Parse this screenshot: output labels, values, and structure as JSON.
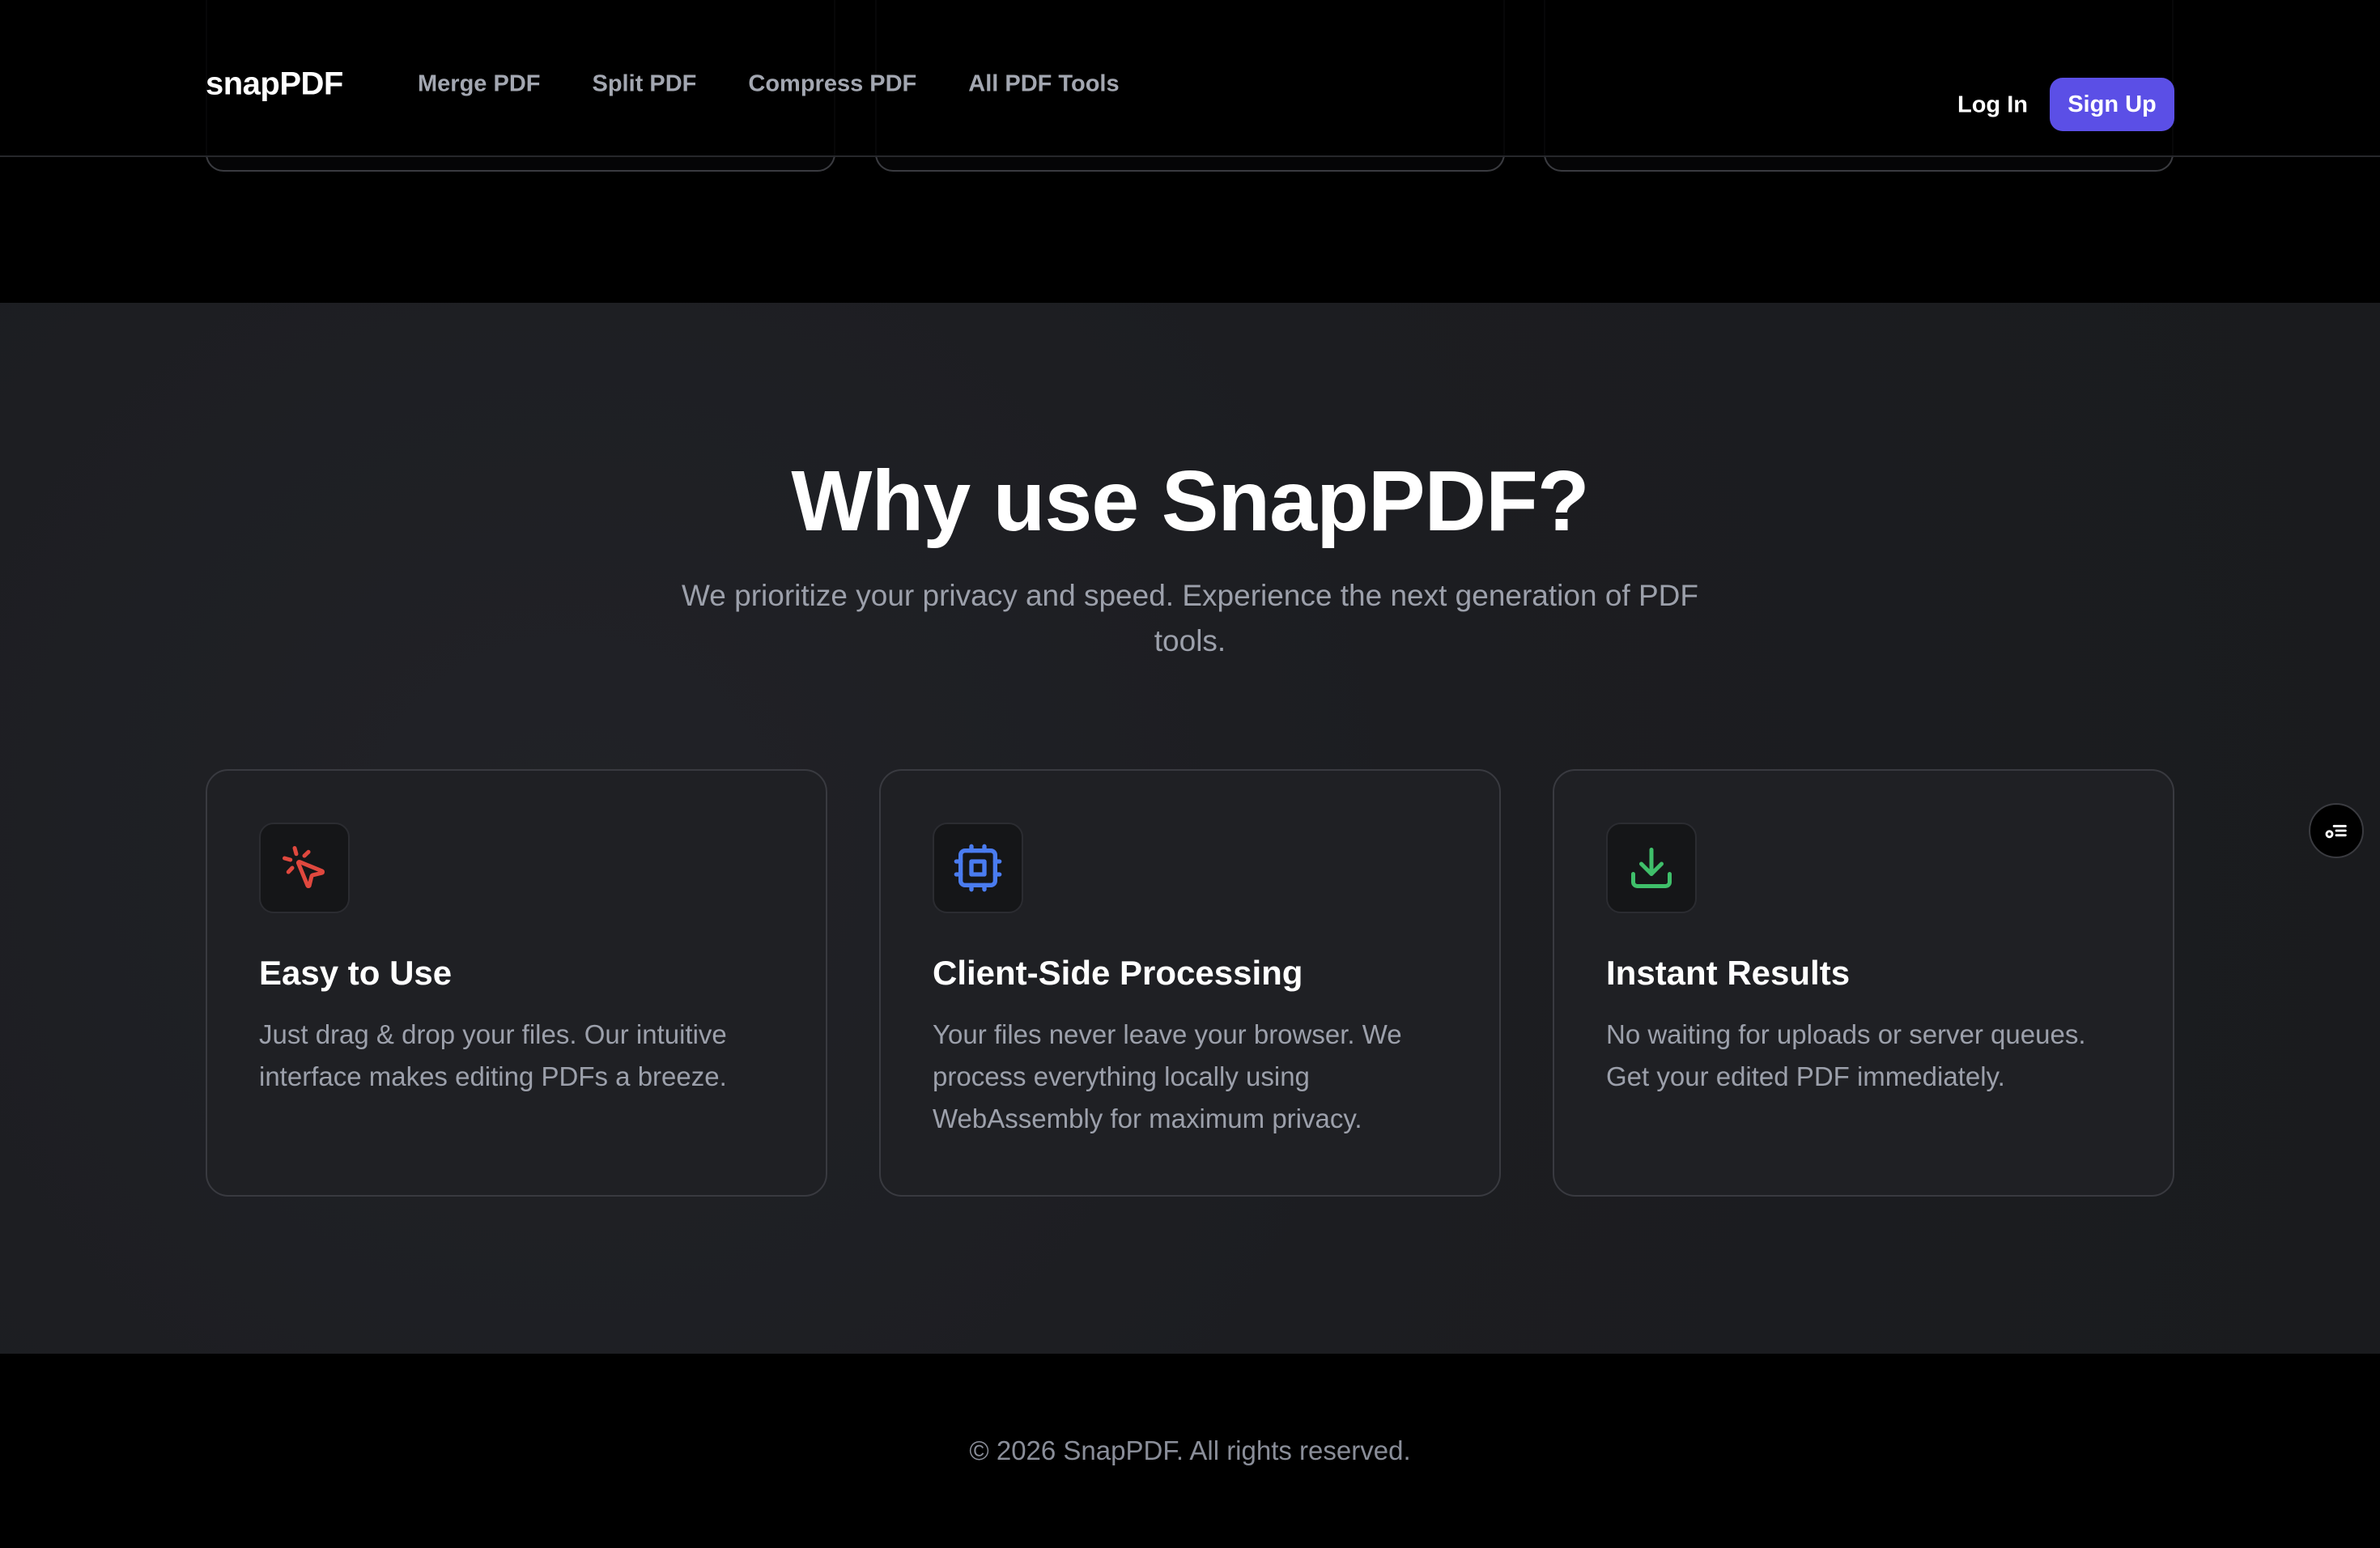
{
  "nav": {
    "brand": "snapPDF",
    "links": [
      "Merge PDF",
      "Split PDF",
      "Compress PDF",
      "All PDF Tools"
    ],
    "login": "Log In",
    "signup": "Sign Up"
  },
  "features": {
    "title": "Why use SnapPDF?",
    "subtitle": "We prioritize your privacy and speed. Experience the next generation of PDF tools.",
    "cards": [
      {
        "icon": "pointer-click-icon",
        "icon_color": "#e0483e",
        "title": "Easy to Use",
        "description": "Just drag & drop your files. Our intuitive interface makes editing PDFs a breeze."
      },
      {
        "icon": "cpu-chip-icon",
        "icon_color": "#4a7cf0",
        "title": "Client-Side Processing",
        "description": "Your files never leave your browser. We process everything locally using WebAssembly for maximum privacy."
      },
      {
        "icon": "download-icon",
        "icon_color": "#3fbf6a",
        "title": "Instant Results",
        "description": "No waiting for uploads or server queues. Get your edited PDF immediately."
      }
    ]
  },
  "footer": {
    "copyright": "© 2026 SnapPDF. All rights reserved."
  },
  "colors": {
    "accent": "#5b4fe6",
    "background": "#000000",
    "section_background": "#1c1d21"
  }
}
